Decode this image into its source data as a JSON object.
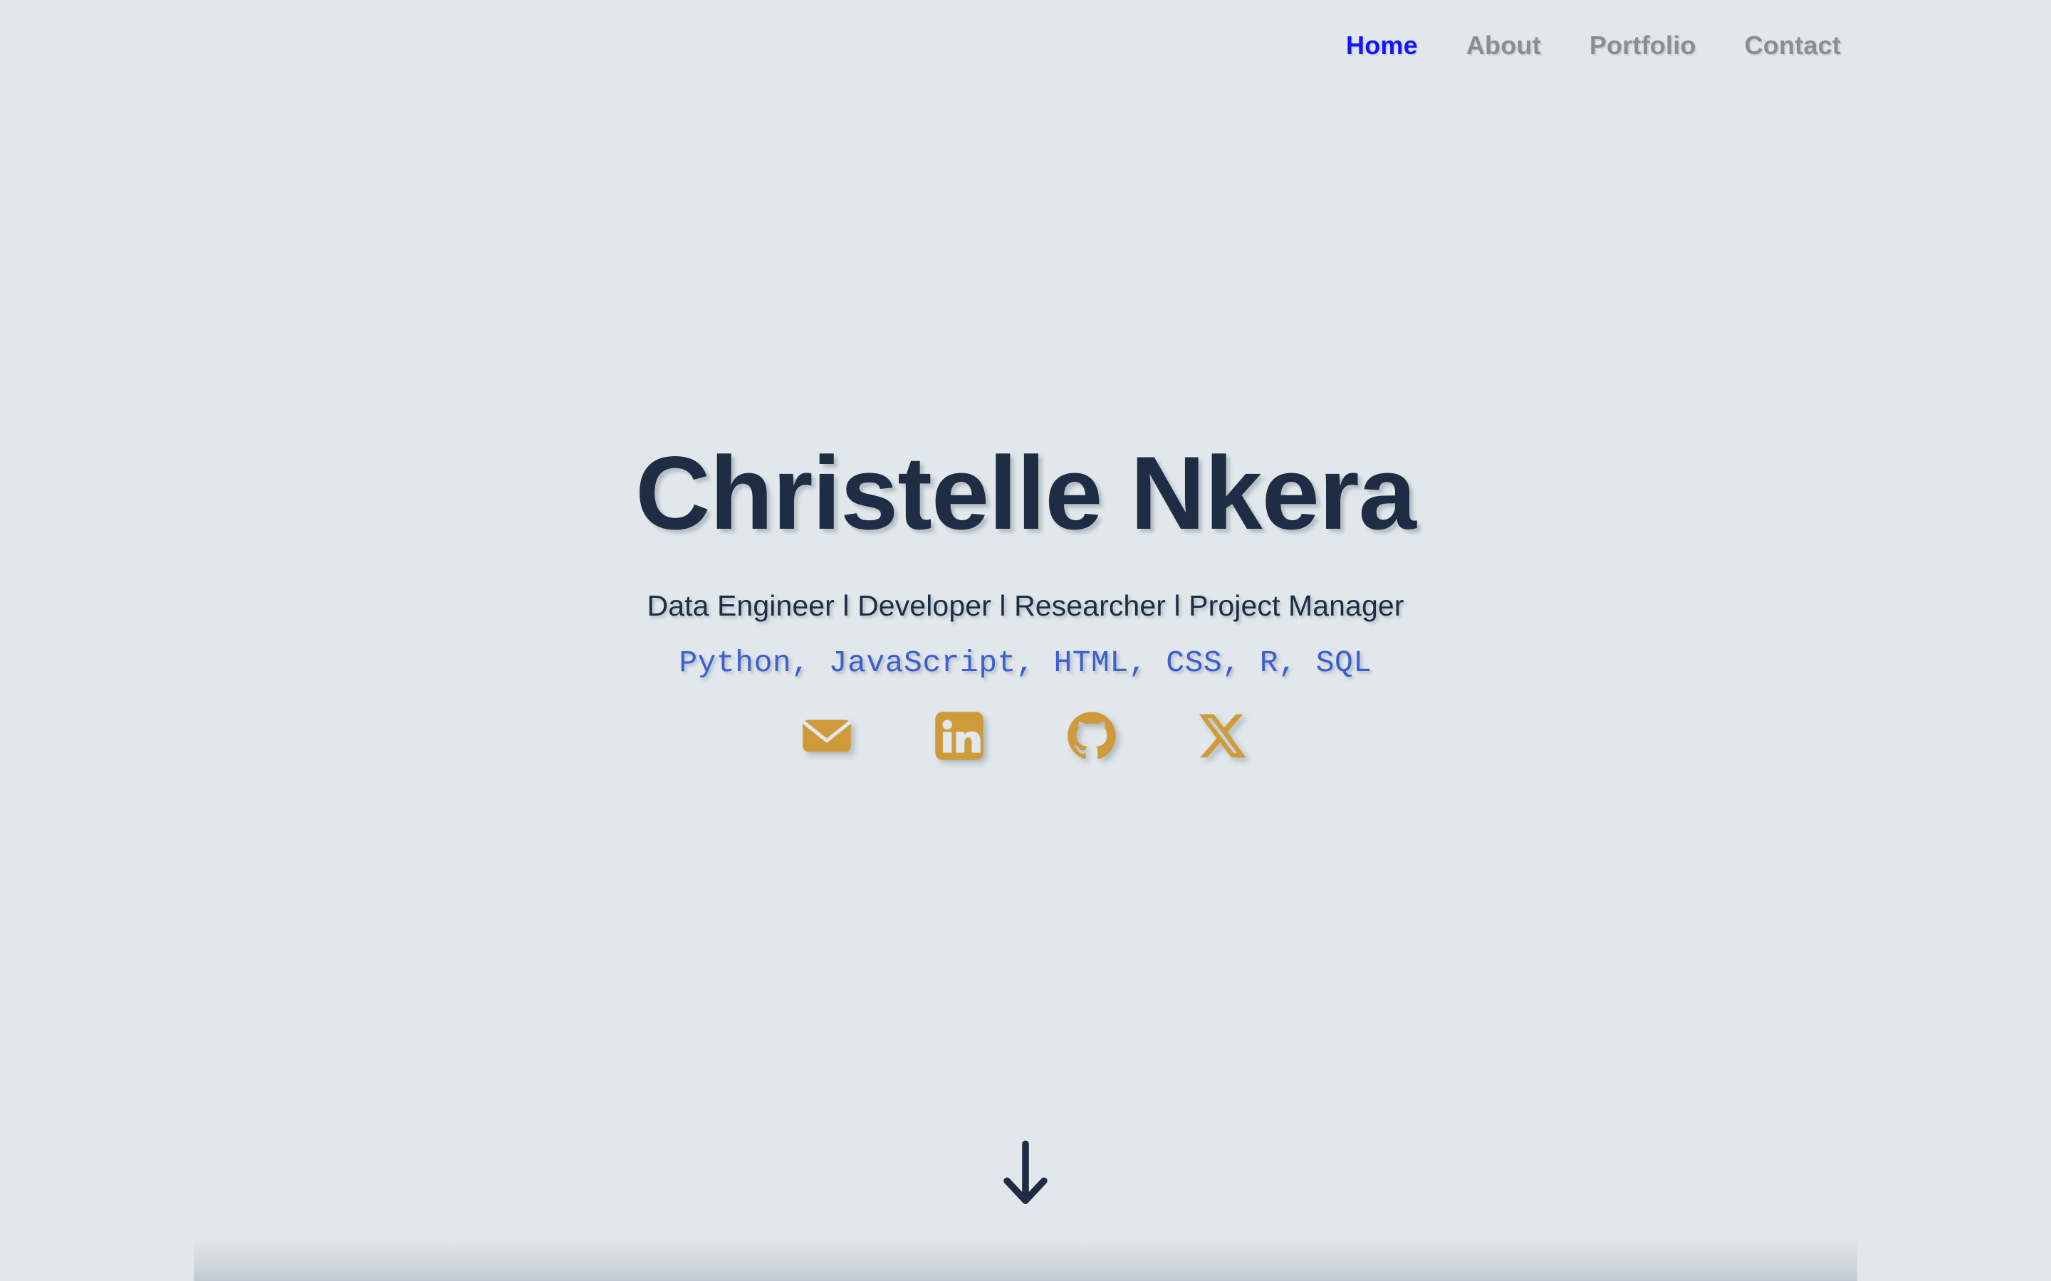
{
  "nav": {
    "items": [
      {
        "label": "Home",
        "active": true
      },
      {
        "label": "About",
        "active": false
      },
      {
        "label": "Portfolio",
        "active": false
      },
      {
        "label": "Contact",
        "active": false
      }
    ]
  },
  "hero": {
    "title": "Christelle Nkera",
    "subtitle": "Data Engineer l Developer l Researcher l Project Manager",
    "skills": "Python, JavaScript, HTML, CSS, R, SQL",
    "social": [
      {
        "name": "email-icon",
        "label": "Email"
      },
      {
        "name": "linkedin-icon",
        "label": "LinkedIn"
      },
      {
        "name": "github-icon",
        "label": "GitHub"
      },
      {
        "name": "x-icon",
        "label": "X"
      }
    ],
    "scroll_hint": "Scroll down"
  },
  "colors": {
    "background": "#e1e7ea",
    "heading": "#1e2c44",
    "accent_blue": "#3b5fd0",
    "nav_active": "#1414ff",
    "nav_inactive": "#8d8d8d",
    "icon_gold": "#cf9b3a"
  }
}
